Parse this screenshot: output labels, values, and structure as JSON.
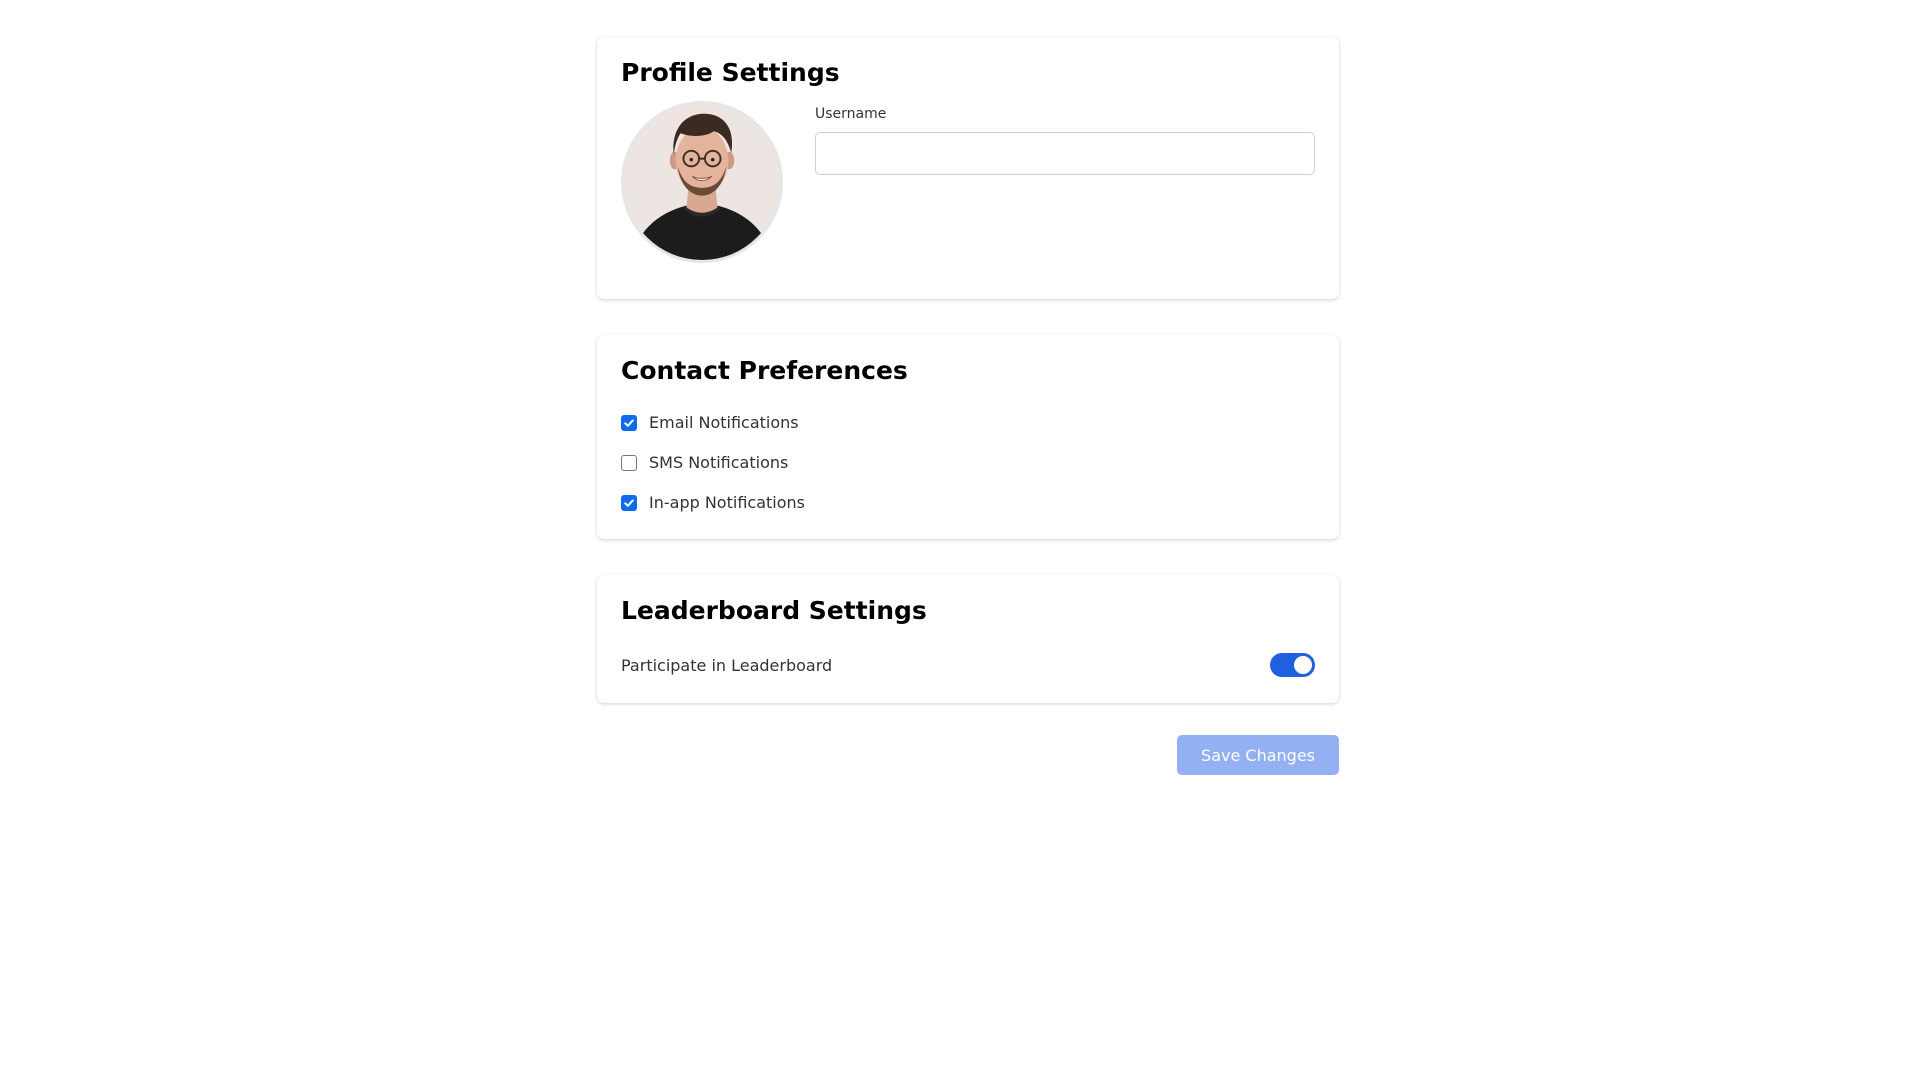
{
  "profile": {
    "title": "Profile Settings",
    "avatar_alt": "avatar",
    "username_label": "Username",
    "username_value": "",
    "username_placeholder": ""
  },
  "contact": {
    "title": "Contact Preferences",
    "options": [
      {
        "label": "Email Notifications",
        "checked": true
      },
      {
        "label": "SMS Notifications",
        "checked": false
      },
      {
        "label": "In-app Notifications",
        "checked": true
      }
    ]
  },
  "leaderboard": {
    "title": "Leaderboard Settings",
    "participate_label": "Participate in Leaderboard",
    "participate_on": true
  },
  "actions": {
    "save_label": "Save Changes"
  },
  "colors": {
    "checkbox_checked": "#0b6cf2",
    "toggle_on": "#1f5fe0",
    "save_button_disabled": "#93b0f3"
  }
}
